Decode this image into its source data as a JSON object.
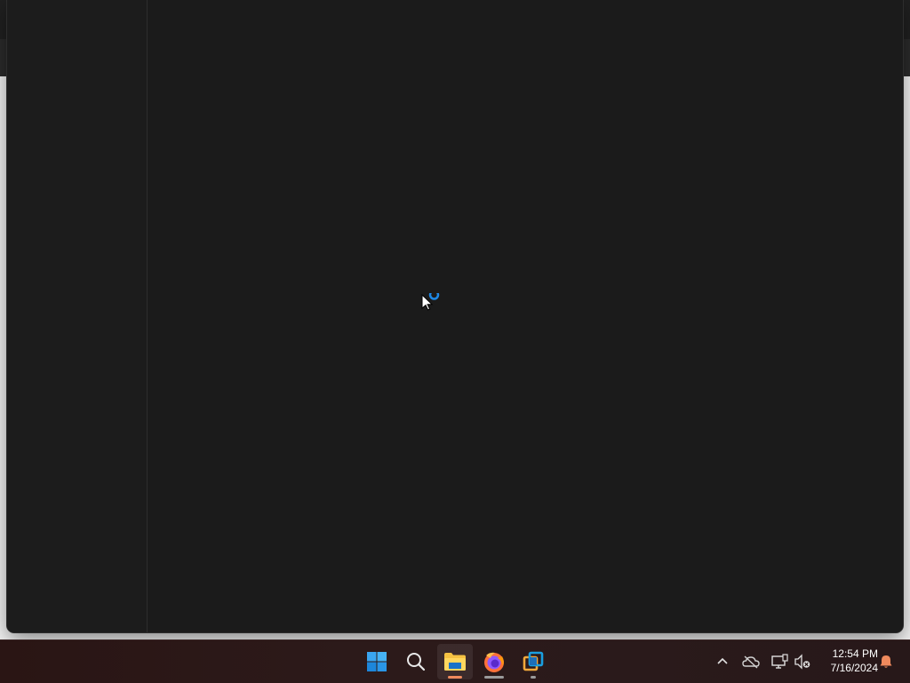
{
  "taskbar": {
    "apps": [
      {
        "name": "start-button",
        "label": "Start"
      },
      {
        "name": "search-button",
        "label": "Search"
      },
      {
        "name": "file-explorer",
        "label": "File Explorer"
      },
      {
        "name": "firefox",
        "label": "Firefox"
      },
      {
        "name": "virtualbox",
        "label": "VirtualBox"
      }
    ],
    "tray": {
      "time": "12:54 PM",
      "date": "7/16/2024"
    }
  },
  "colors": {
    "accent": "#0078d4",
    "explorer_bg": "#1b1b1b",
    "active_indicator": "#f08a5d"
  }
}
